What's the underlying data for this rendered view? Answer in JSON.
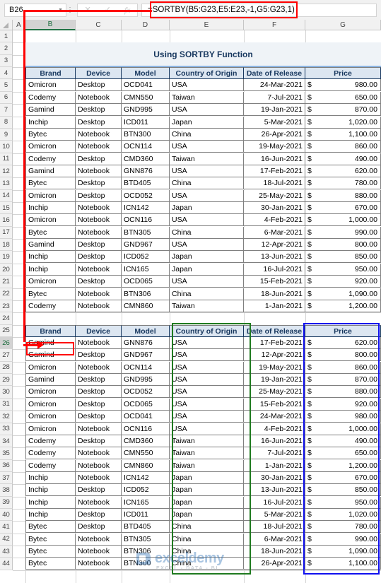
{
  "formula_bar": {
    "name_box_value": "B26",
    "formula": "=SORTBY(B5:G23,E5:E23,-1,G5:G23,1)",
    "cancel_icon": "close-icon",
    "confirm_icon": "check-icon",
    "function_icon": "fx-icon",
    "dropdown_icon": "chevron-down-icon"
  },
  "columns": [
    "A",
    "B",
    "C",
    "D",
    "E",
    "F",
    "G"
  ],
  "selected_column": "B",
  "selected_row": 26,
  "rows": [
    1,
    2,
    3,
    4,
    5,
    6,
    7,
    8,
    9,
    10,
    11,
    12,
    13,
    14,
    15,
    16,
    17,
    18,
    19,
    20,
    21,
    22,
    23,
    24,
    25,
    26,
    27,
    28,
    29,
    30,
    31,
    32,
    33,
    34,
    35,
    36,
    37,
    38,
    39,
    40,
    41,
    42,
    43,
    44
  ],
  "title": "Using SORTBY Function",
  "table_headers": [
    "Brand",
    "Device",
    "Model",
    "Country of Origin",
    "Date of Release",
    "Price"
  ],
  "source_table": [
    {
      "brand": "Omicron",
      "device": "Desktop",
      "model": "OCD041",
      "country": "USA",
      "date": "24-Mar-2021",
      "currency": "$",
      "price": "980.00"
    },
    {
      "brand": "Codemy",
      "device": "Notebook",
      "model": "CMN550",
      "country": "Taiwan",
      "date": "7-Jul-2021",
      "currency": "$",
      "price": "650.00"
    },
    {
      "brand": "Gamind",
      "device": "Desktop",
      "model": "GND995",
      "country": "USA",
      "date": "19-Jan-2021",
      "currency": "$",
      "price": "870.00"
    },
    {
      "brand": "Inchip",
      "device": "Desktop",
      "model": "ICD011",
      "country": "Japan",
      "date": "5-Mar-2021",
      "currency": "$",
      "price": "1,020.00"
    },
    {
      "brand": "Bytec",
      "device": "Notebook",
      "model": "BTN300",
      "country": "China",
      "date": "26-Apr-2021",
      "currency": "$",
      "price": "1,100.00"
    },
    {
      "brand": "Omicron",
      "device": "Notebook",
      "model": "OCN114",
      "country": "USA",
      "date": "19-May-2021",
      "currency": "$",
      "price": "860.00"
    },
    {
      "brand": "Codemy",
      "device": "Desktop",
      "model": "CMD360",
      "country": "Taiwan",
      "date": "16-Jun-2021",
      "currency": "$",
      "price": "490.00"
    },
    {
      "brand": "Gamind",
      "device": "Notebook",
      "model": "GNN876",
      "country": "USA",
      "date": "17-Feb-2021",
      "currency": "$",
      "price": "620.00"
    },
    {
      "brand": "Bytec",
      "device": "Desktop",
      "model": "BTD405",
      "country": "China",
      "date": "18-Jul-2021",
      "currency": "$",
      "price": "780.00"
    },
    {
      "brand": "Omicron",
      "device": "Desktop",
      "model": "OCD052",
      "country": "USA",
      "date": "25-May-2021",
      "currency": "$",
      "price": "880.00"
    },
    {
      "brand": "Inchip",
      "device": "Notebook",
      "model": "ICN142",
      "country": "Japan",
      "date": "30-Jan-2021",
      "currency": "$",
      "price": "670.00"
    },
    {
      "brand": "Omicron",
      "device": "Notebook",
      "model": "OCN116",
      "country": "USA",
      "date": "4-Feb-2021",
      "currency": "$",
      "price": "1,000.00"
    },
    {
      "brand": "Bytec",
      "device": "Notebook",
      "model": "BTN305",
      "country": "China",
      "date": "6-Mar-2021",
      "currency": "$",
      "price": "990.00"
    },
    {
      "brand": "Gamind",
      "device": "Desktop",
      "model": "GND967",
      "country": "USA",
      "date": "12-Apr-2021",
      "currency": "$",
      "price": "800.00"
    },
    {
      "brand": "Inchip",
      "device": "Desktop",
      "model": "ICD052",
      "country": "Japan",
      "date": "13-Jun-2021",
      "currency": "$",
      "price": "850.00"
    },
    {
      "brand": "Inchip",
      "device": "Notebook",
      "model": "ICN165",
      "country": "Japan",
      "date": "16-Jul-2021",
      "currency": "$",
      "price": "950.00"
    },
    {
      "brand": "Omicron",
      "device": "Desktop",
      "model": "OCD065",
      "country": "USA",
      "date": "15-Feb-2021",
      "currency": "$",
      "price": "920.00"
    },
    {
      "brand": "Bytec",
      "device": "Notebook",
      "model": "BTN306",
      "country": "China",
      "date": "18-Jun-2021",
      "currency": "$",
      "price": "1,090.00"
    },
    {
      "brand": "Codemy",
      "device": "Notebook",
      "model": "CMN860",
      "country": "Taiwan",
      "date": "1-Jan-2021",
      "currency": "$",
      "price": "1,200.00"
    }
  ],
  "result_table": [
    {
      "brand": "Gamind",
      "device": "Notebook",
      "model": "GNN876",
      "country": "USA",
      "date": "17-Feb-2021",
      "currency": "$",
      "price": "620.00"
    },
    {
      "brand": "Gamind",
      "device": "Desktop",
      "model": "GND967",
      "country": "USA",
      "date": "12-Apr-2021",
      "currency": "$",
      "price": "800.00"
    },
    {
      "brand": "Omicron",
      "device": "Notebook",
      "model": "OCN114",
      "country": "USA",
      "date": "19-May-2021",
      "currency": "$",
      "price": "860.00"
    },
    {
      "brand": "Gamind",
      "device": "Desktop",
      "model": "GND995",
      "country": "USA",
      "date": "19-Jan-2021",
      "currency": "$",
      "price": "870.00"
    },
    {
      "brand": "Omicron",
      "device": "Desktop",
      "model": "OCD052",
      "country": "USA",
      "date": "25-May-2021",
      "currency": "$",
      "price": "880.00"
    },
    {
      "brand": "Omicron",
      "device": "Desktop",
      "model": "OCD065",
      "country": "USA",
      "date": "15-Feb-2021",
      "currency": "$",
      "price": "920.00"
    },
    {
      "brand": "Omicron",
      "device": "Desktop",
      "model": "OCD041",
      "country": "USA",
      "date": "24-Mar-2021",
      "currency": "$",
      "price": "980.00"
    },
    {
      "brand": "Omicron",
      "device": "Notebook",
      "model": "OCN116",
      "country": "USA",
      "date": "4-Feb-2021",
      "currency": "$",
      "price": "1,000.00"
    },
    {
      "brand": "Codemy",
      "device": "Desktop",
      "model": "CMD360",
      "country": "Taiwan",
      "date": "16-Jun-2021",
      "currency": "$",
      "price": "490.00"
    },
    {
      "brand": "Codemy",
      "device": "Notebook",
      "model": "CMN550",
      "country": "Taiwan",
      "date": "7-Jul-2021",
      "currency": "$",
      "price": "650.00"
    },
    {
      "brand": "Codemy",
      "device": "Notebook",
      "model": "CMN860",
      "country": "Taiwan",
      "date": "1-Jan-2021",
      "currency": "$",
      "price": "1,200.00"
    },
    {
      "brand": "Inchip",
      "device": "Notebook",
      "model": "ICN142",
      "country": "Japan",
      "date": "30-Jan-2021",
      "currency": "$",
      "price": "670.00"
    },
    {
      "brand": "Inchip",
      "device": "Desktop",
      "model": "ICD052",
      "country": "Japan",
      "date": "13-Jun-2021",
      "currency": "$",
      "price": "850.00"
    },
    {
      "brand": "Inchip",
      "device": "Notebook",
      "model": "ICN165",
      "country": "Japan",
      "date": "16-Jul-2021",
      "currency": "$",
      "price": "950.00"
    },
    {
      "brand": "Inchip",
      "device": "Desktop",
      "model": "ICD011",
      "country": "Japan",
      "date": "5-Mar-2021",
      "currency": "$",
      "price": "1,020.00"
    },
    {
      "brand": "Bytec",
      "device": "Desktop",
      "model": "BTD405",
      "country": "China",
      "date": "18-Jul-2021",
      "currency": "$",
      "price": "780.00"
    },
    {
      "brand": "Bytec",
      "device": "Notebook",
      "model": "BTN305",
      "country": "China",
      "date": "6-Mar-2021",
      "currency": "$",
      "price": "990.00"
    },
    {
      "brand": "Bytec",
      "device": "Notebook",
      "model": "BTN306",
      "country": "China",
      "date": "18-Jun-2021",
      "currency": "$",
      "price": "1,090.00"
    },
    {
      "brand": "Bytec",
      "device": "Notebook",
      "model": "BTN300",
      "country": "China",
      "date": "26-Apr-2021",
      "currency": "$",
      "price": "1,100.00"
    }
  ],
  "annotations": {
    "formula_highlight_color": "#ff0000",
    "arrow_color": "#ff0000",
    "sort_key_box_color": "#1f7a1f",
    "tiebreak_box_color": "#1010ee",
    "selected_cell_box_color": "#ff0000"
  },
  "watermark": {
    "brand": "exceldemy",
    "tagline": "EXCEL - DATA - BI"
  }
}
